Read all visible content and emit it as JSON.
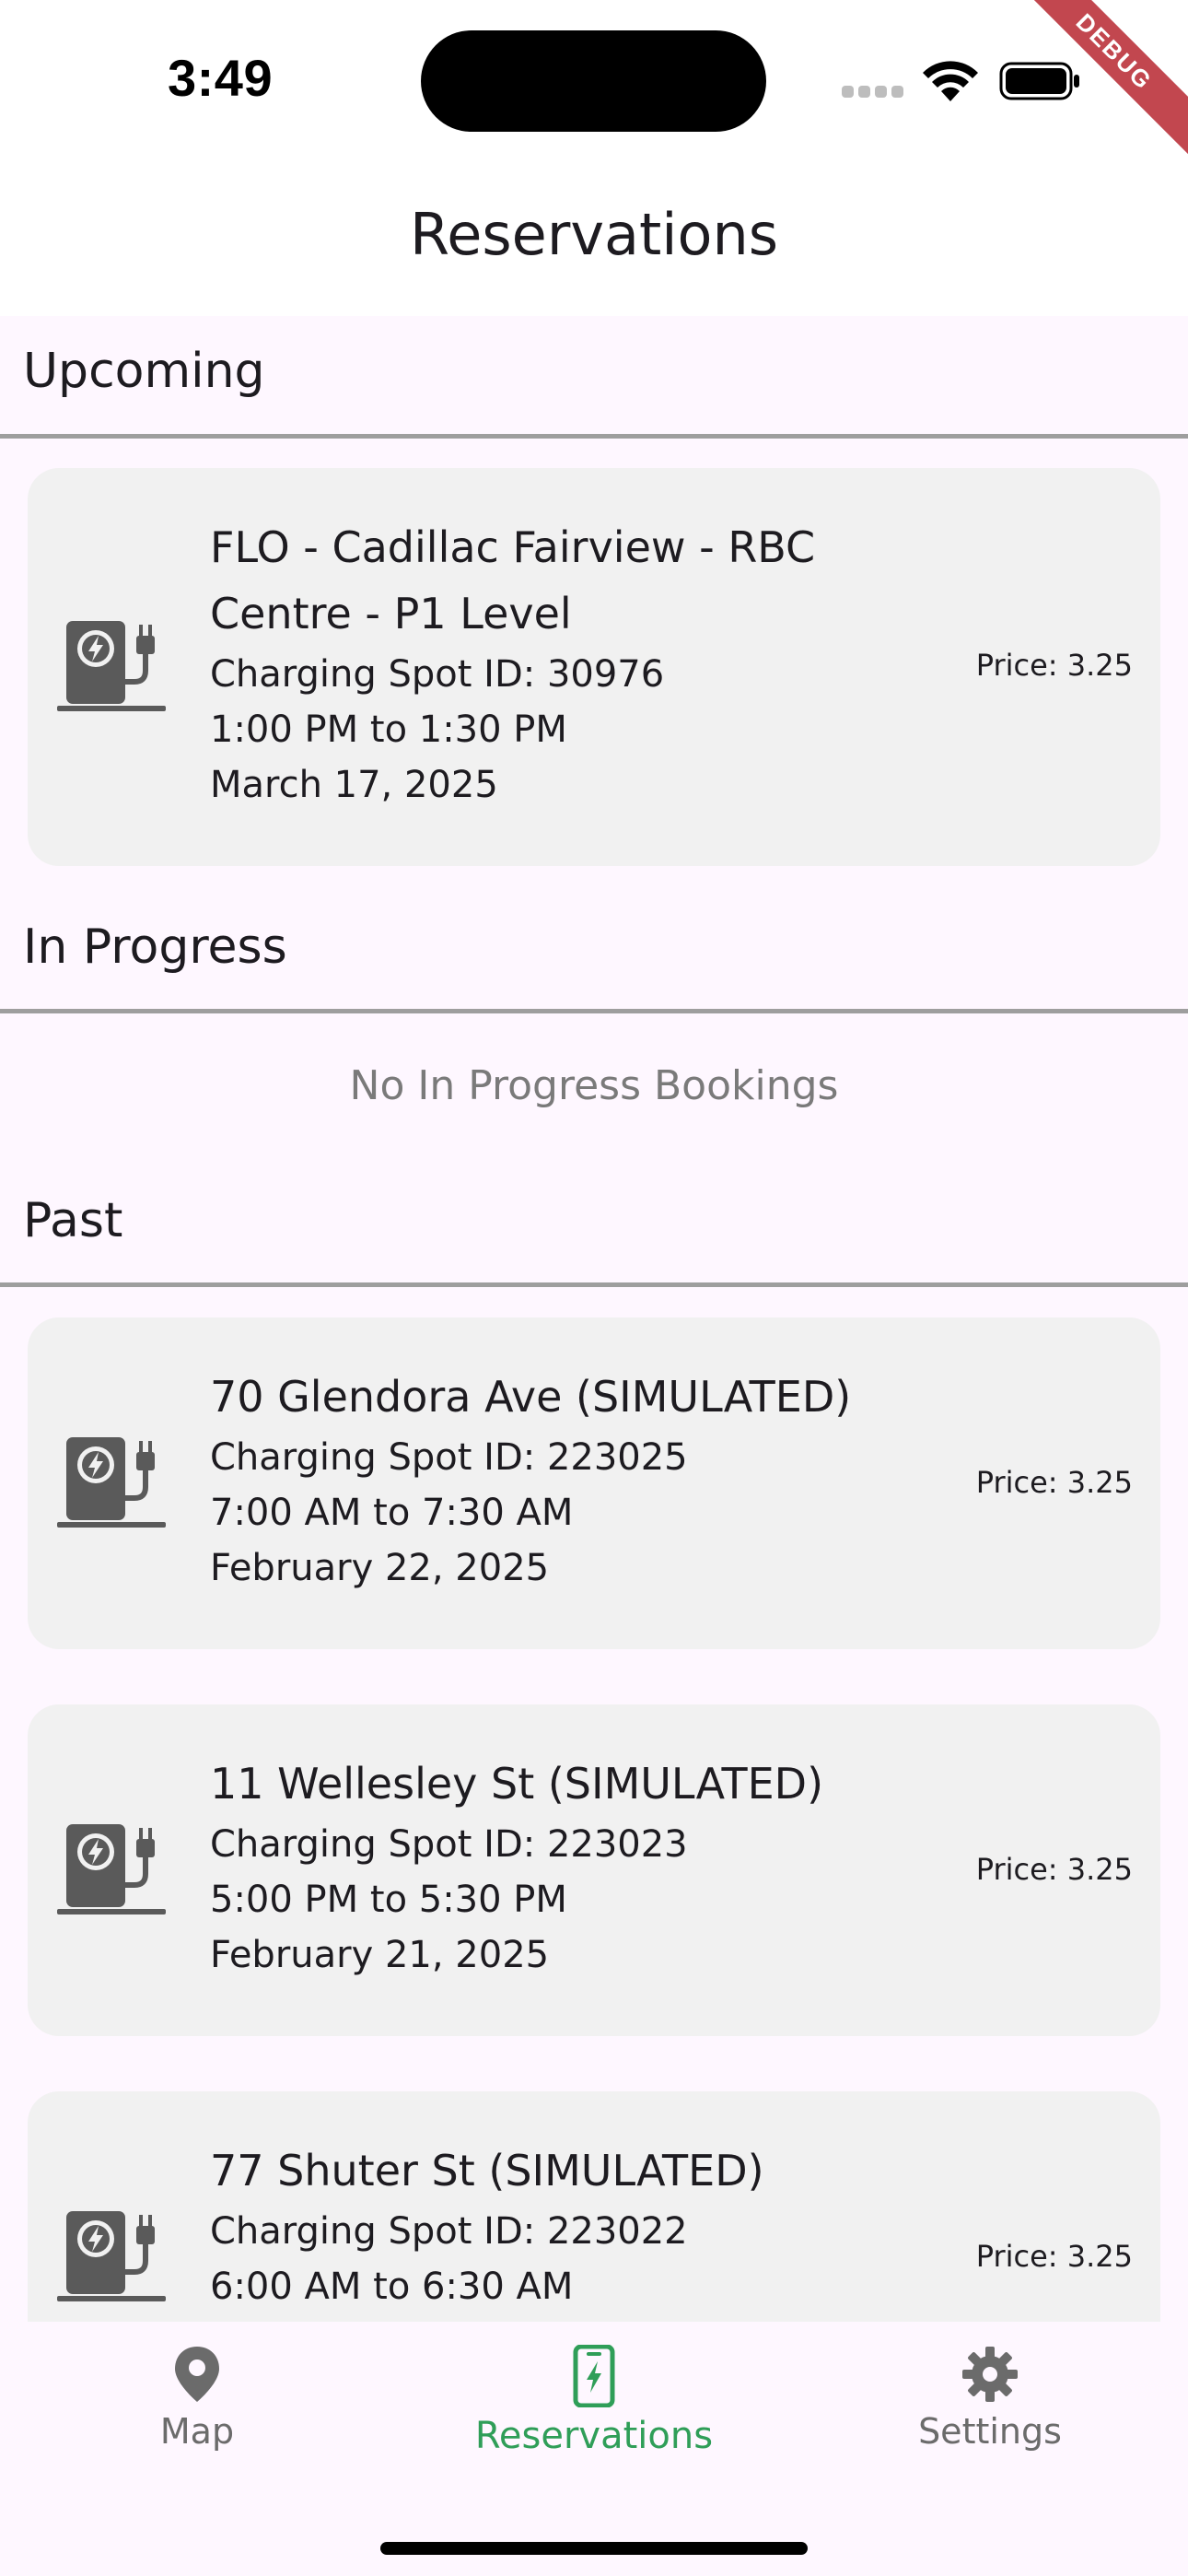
{
  "status_bar": {
    "time": "3:49",
    "debug_label": "DEBUG",
    "icons": [
      "cellular-signal-icon",
      "wifi-icon",
      "battery-icon"
    ]
  },
  "header": {
    "title": "Reservations"
  },
  "sections": {
    "upcoming": {
      "title": "Upcoming",
      "items": [
        {
          "title_line1": "FLO - Cadillac Fairview - RBC",
          "title_line2": "Centre - P1 Level",
          "spot": "Charging Spot ID: 30976",
          "time": "1:00 PM to 1:30 PM",
          "date": "March 17, 2025",
          "price": "Price: 3.25",
          "icon": "ev-charger-icon"
        }
      ]
    },
    "in_progress": {
      "title": "In Progress",
      "empty_message": "No In Progress Bookings"
    },
    "past": {
      "title": "Past",
      "items": [
        {
          "title": "70 Glendora Ave (SIMULATED)",
          "spot": "Charging Spot ID: 223025",
          "time": "7:00 AM to 7:30 AM",
          "date": "February 22, 2025",
          "price": "Price: 3.25",
          "icon": "ev-charger-icon"
        },
        {
          "title": "11 Wellesley St (SIMULATED)",
          "spot": "Charging Spot ID: 223023",
          "time": "5:00 PM to 5:30 PM",
          "date": "February 21, 2025",
          "price": "Price: 3.25",
          "icon": "ev-charger-icon"
        },
        {
          "title": "77 Shuter St (SIMULATED)",
          "spot": "Charging Spot ID: 223022",
          "time": "6:00 AM to 6:30 AM",
          "price": "Price: 3.25",
          "icon": "ev-charger-icon"
        }
      ]
    }
  },
  "bottom_nav": {
    "items": [
      {
        "label": "Map",
        "icon": "map-pin-icon",
        "active": false
      },
      {
        "label": "Reservations",
        "icon": "charging-phone-icon",
        "active": true
      },
      {
        "label": "Settings",
        "icon": "gear-icon",
        "active": false
      }
    ]
  },
  "colors": {
    "background": "#FEF7FF",
    "card": "#F1F1F1",
    "accent_green": "#2F9E58",
    "icon_gray": "#5A5A5A",
    "divider": "#9E9E9E",
    "debug_banner": "#B41E28"
  }
}
